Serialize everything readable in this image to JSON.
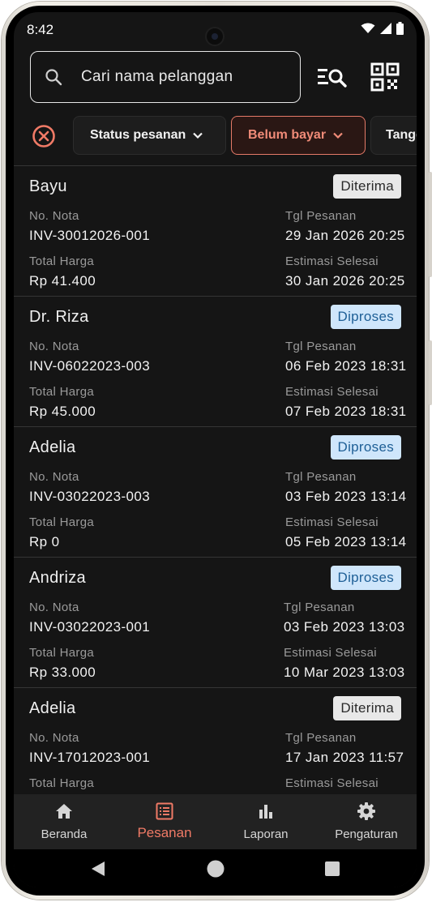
{
  "status_bar": {
    "time": "8:42"
  },
  "search": {
    "placeholder": "Cari nama pelanggan"
  },
  "filters": {
    "status_label": "Status pesanan",
    "payment_label": "Belum bayar",
    "date_label": "Tanggal"
  },
  "labels": {
    "invoice": "No. Nota",
    "order_date": "Tgl Pesanan",
    "total": "Total Harga",
    "estimate": "Estimasi Selesai"
  },
  "orders": [
    {
      "customer": "Bayu",
      "status": "Diterima",
      "invoice": "INV-30012026-001",
      "order_date": "29 Jan 2026 20:25",
      "total": "Rp 41.400",
      "estimate": "30 Jan 2026 20:25"
    },
    {
      "customer": "Dr. Riza",
      "status": "Diproses",
      "invoice": "INV-06022023-003",
      "order_date": "06 Feb 2023 18:31",
      "total": "Rp 45.000",
      "estimate": "07 Feb 2023 18:31"
    },
    {
      "customer": "Adelia",
      "status": "Diproses",
      "invoice": "INV-03022023-003",
      "order_date": "03 Feb 2023 13:14",
      "total": "Rp 0",
      "estimate": "05 Feb 2023 13:14"
    },
    {
      "customer": "Andriza",
      "status": "Diproses",
      "invoice": "INV-03022023-001",
      "order_date": "03 Feb 2023 13:03",
      "total": "Rp 33.000",
      "estimate": "10 Mar 2023 13:03"
    },
    {
      "customer": "Adelia",
      "status": "Diterima",
      "invoice": "INV-17012023-001",
      "order_date": "17 Jan 2023 11:57",
      "total": "",
      "estimate": ""
    }
  ],
  "nav": [
    {
      "label": "Beranda",
      "icon": "home-icon"
    },
    {
      "label": "Pesanan",
      "icon": "receipt-list-icon",
      "active": true
    },
    {
      "label": "Laporan",
      "icon": "bar-chart-icon"
    },
    {
      "label": "Pengaturan",
      "icon": "gear-icon"
    }
  ],
  "colors": {
    "accent": "#f07a66",
    "background": "#151515",
    "badge_received_bg": "#e8e8e8",
    "badge_processing_bg": "#cfe6fb",
    "badge_processing_text": "#1e5f96"
  }
}
